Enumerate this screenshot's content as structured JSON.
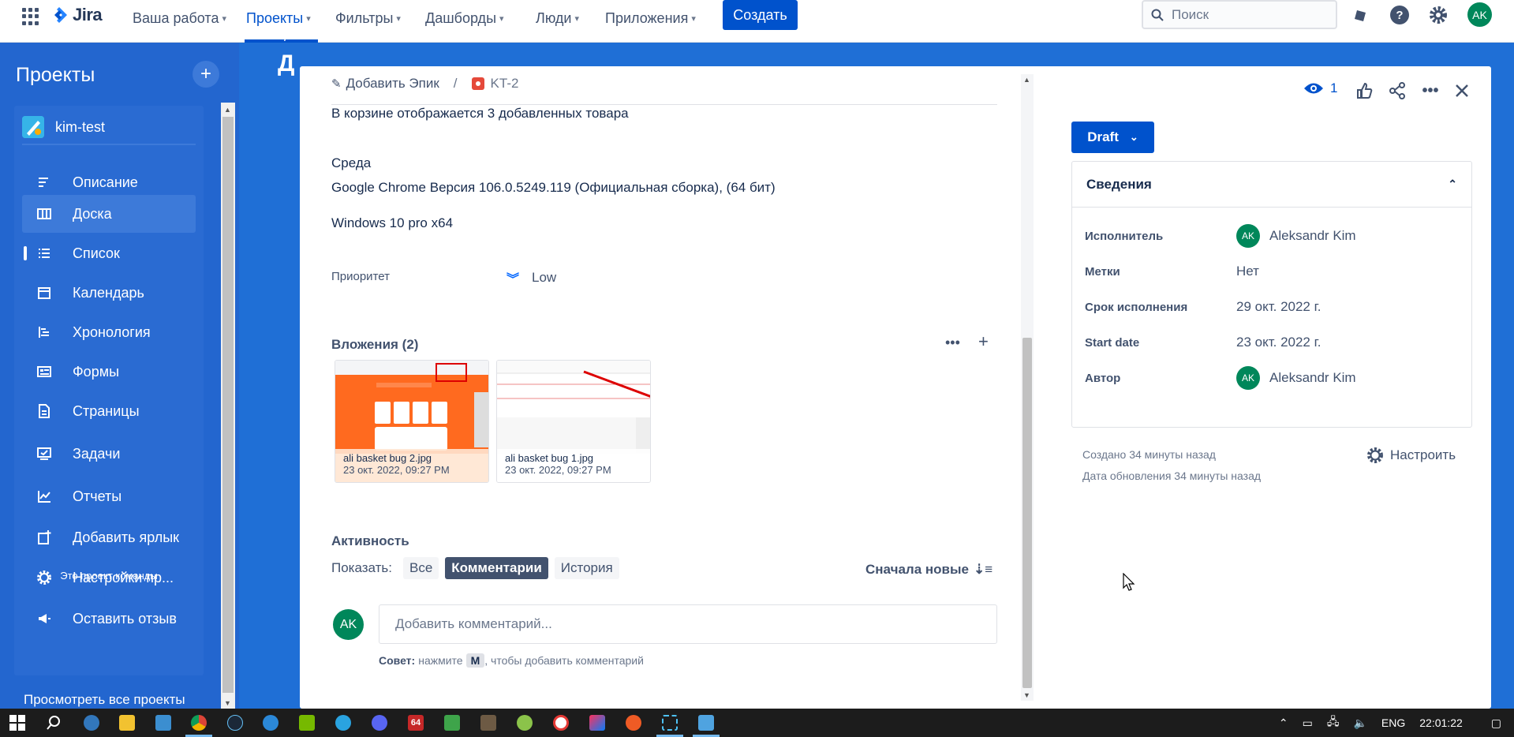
{
  "topnav": {
    "logo_text": "Jira",
    "items": [
      {
        "label": "Ваша работа"
      },
      {
        "label": "Проекты"
      },
      {
        "label": "Фильтры"
      },
      {
        "label": "Дашборды"
      },
      {
        "label": "Люди"
      },
      {
        "label": "Приложения"
      }
    ],
    "create_label": "Создать",
    "search_placeholder": "Поиск",
    "avatar": "AK"
  },
  "sidebar": {
    "title": "Проекты",
    "project_name": "kim-test",
    "items": [
      {
        "label": "Описание",
        "icon": "description-icon"
      },
      {
        "label": "Доска",
        "icon": "board-icon"
      },
      {
        "label": "Список",
        "icon": "list-icon"
      },
      {
        "label": "Календарь",
        "icon": "calendar-icon"
      },
      {
        "label": "Хронология",
        "icon": "timeline-icon"
      },
      {
        "label": "Формы",
        "icon": "forms-icon"
      },
      {
        "label": "Страницы",
        "icon": "pages-icon"
      },
      {
        "label": "Задачи",
        "icon": "tasks-icon"
      },
      {
        "label": "Отчеты",
        "icon": "reports-icon"
      },
      {
        "label": "Добавить ярлык",
        "icon": "add-shortcut-icon"
      },
      {
        "label": "Настройки пр...",
        "icon": "settings-icon"
      },
      {
        "label": "Оставить отзыв",
        "icon": "megaphone-icon"
      }
    ],
    "footer": "Это проект команды",
    "view_all": "Просмотреть все проекты"
  },
  "background": {
    "crumb": "/",
    "title_fragment": "Д"
  },
  "issue": {
    "add_epic": "Добавить Эпик",
    "crumb_sep": "/",
    "key": "KT-2",
    "line_cart": "В корзине отображается 3 добавленных товара",
    "env_heading": "Среда",
    "env_line1": "Google Chrome Версия 106.0.5249.119 (Официальная сборка), (64 бит)",
    "env_line2": "Windows 10 pro  x64",
    "priority_label": "Приоритет",
    "priority_value": "Low",
    "attachments_heading": "Вложения (2)",
    "attachments": [
      {
        "name": "ali basket bug 2.jpg",
        "date": "23 окт. 2022, 09:27 PM"
      },
      {
        "name": "ali basket bug 1.jpg",
        "date": "23 окт. 2022, 09:27 PM"
      }
    ],
    "activity_heading": "Активность",
    "show_label": "Показать:",
    "filters": [
      "Все",
      "Комментарии",
      "История"
    ],
    "sort_label": "Сначала новые",
    "comment_avatar": "AK",
    "comment_placeholder": "Добавить комментарий...",
    "tip_prefix": "Совет:",
    "tip_text_a": "нажмите",
    "tip_key": "M",
    "tip_text_b": ", чтобы добавить комментарий"
  },
  "right_panel": {
    "watch_count": "1",
    "status": "Draft",
    "details_heading": "Сведения",
    "rows": [
      {
        "label": "Исполнитель",
        "value": "Aleksandr Kim",
        "avatar": "AK"
      },
      {
        "label": "Метки",
        "value": "Нет"
      },
      {
        "label": "Срок исполнения",
        "value": "29 окт. 2022 г."
      },
      {
        "label": "Start date",
        "value": "23 окт. 2022 г."
      },
      {
        "label": "Автор",
        "value": "Aleksandr Kim",
        "avatar": "AK"
      }
    ],
    "created": "Создано 34 минуты назад",
    "updated": "Дата обновления 34 минуты назад",
    "configure": "Настроить"
  },
  "taskbar": {
    "lang": "ENG",
    "time": "22:01:22",
    "app_badge": "64"
  },
  "colors": {
    "brand": "#0052cc",
    "sidebar": "#2366cf",
    "avatar": "#00875a"
  }
}
